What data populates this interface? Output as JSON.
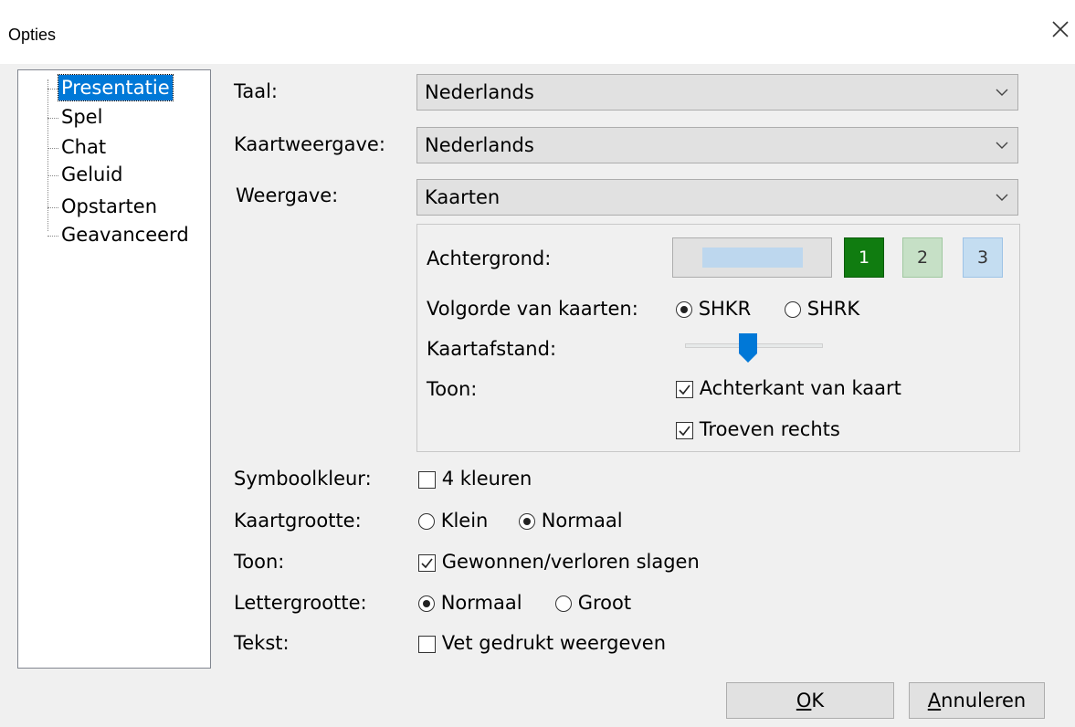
{
  "window": {
    "title": "Opties"
  },
  "tree": {
    "items": [
      {
        "label": "Presentatie",
        "selected": true
      },
      {
        "label": "Spel"
      },
      {
        "label": "Chat"
      },
      {
        "label": "Geluid"
      },
      {
        "label": "Opstarten"
      },
      {
        "label": "Geavanceerd"
      }
    ]
  },
  "form": {
    "language": {
      "label": "Taal:",
      "value": "Nederlands"
    },
    "card_display": {
      "label": "Kaartweergave:",
      "value": "Nederlands"
    },
    "display": {
      "label": "Weergave:",
      "value": "Kaarten"
    }
  },
  "group": {
    "background": {
      "label": "Achtergrond:",
      "swatch_color": "#bdd7ee",
      "presets": [
        {
          "label": "1",
          "bg": "#107c10",
          "fg": "#ffffff",
          "border": "#0a5c0a"
        },
        {
          "label": "2",
          "bg": "#c6e0c6",
          "fg": "#333333",
          "border": "#a0c8a0"
        },
        {
          "label": "3",
          "bg": "#c4ddf1",
          "fg": "#333333",
          "border": "#9dc3e6"
        }
      ]
    },
    "card_order": {
      "label": "Volgorde van kaarten:",
      "opt1": "SHKR",
      "opt2": "SHRK",
      "selected": "SHKR"
    },
    "card_spacing": {
      "label": "Kaartafstand:",
      "value_fraction": 0.4
    },
    "show": {
      "label": "Toon:",
      "check1": "Achterkant van kaart",
      "check2": "Troeven rechts"
    }
  },
  "lower": {
    "symbol_color": {
      "label": "Symboolkleur:",
      "check": "4 kleuren",
      "checked": false
    },
    "card_size": {
      "label": "Kaartgrootte:",
      "opt1": "Klein",
      "opt2": "Normaal",
      "selected": "Normaal"
    },
    "show": {
      "label": "Toon:",
      "check": "Gewonnen/verloren slagen",
      "checked": true
    },
    "font_size": {
      "label": "Lettergrootte:",
      "opt1": "Normaal",
      "opt2": "Groot",
      "selected": "Normaal"
    },
    "text": {
      "label": "Tekst:",
      "check": "Vet gedrukt weergeven",
      "checked": false
    }
  },
  "buttons": {
    "ok_mnemonic": "O",
    "ok_rest": "K",
    "cancel_mnemonic": "A",
    "cancel_rest": "nnuleren"
  },
  "colors": {
    "accent": "#0078d7",
    "slider_thumb": "#0078d7"
  }
}
